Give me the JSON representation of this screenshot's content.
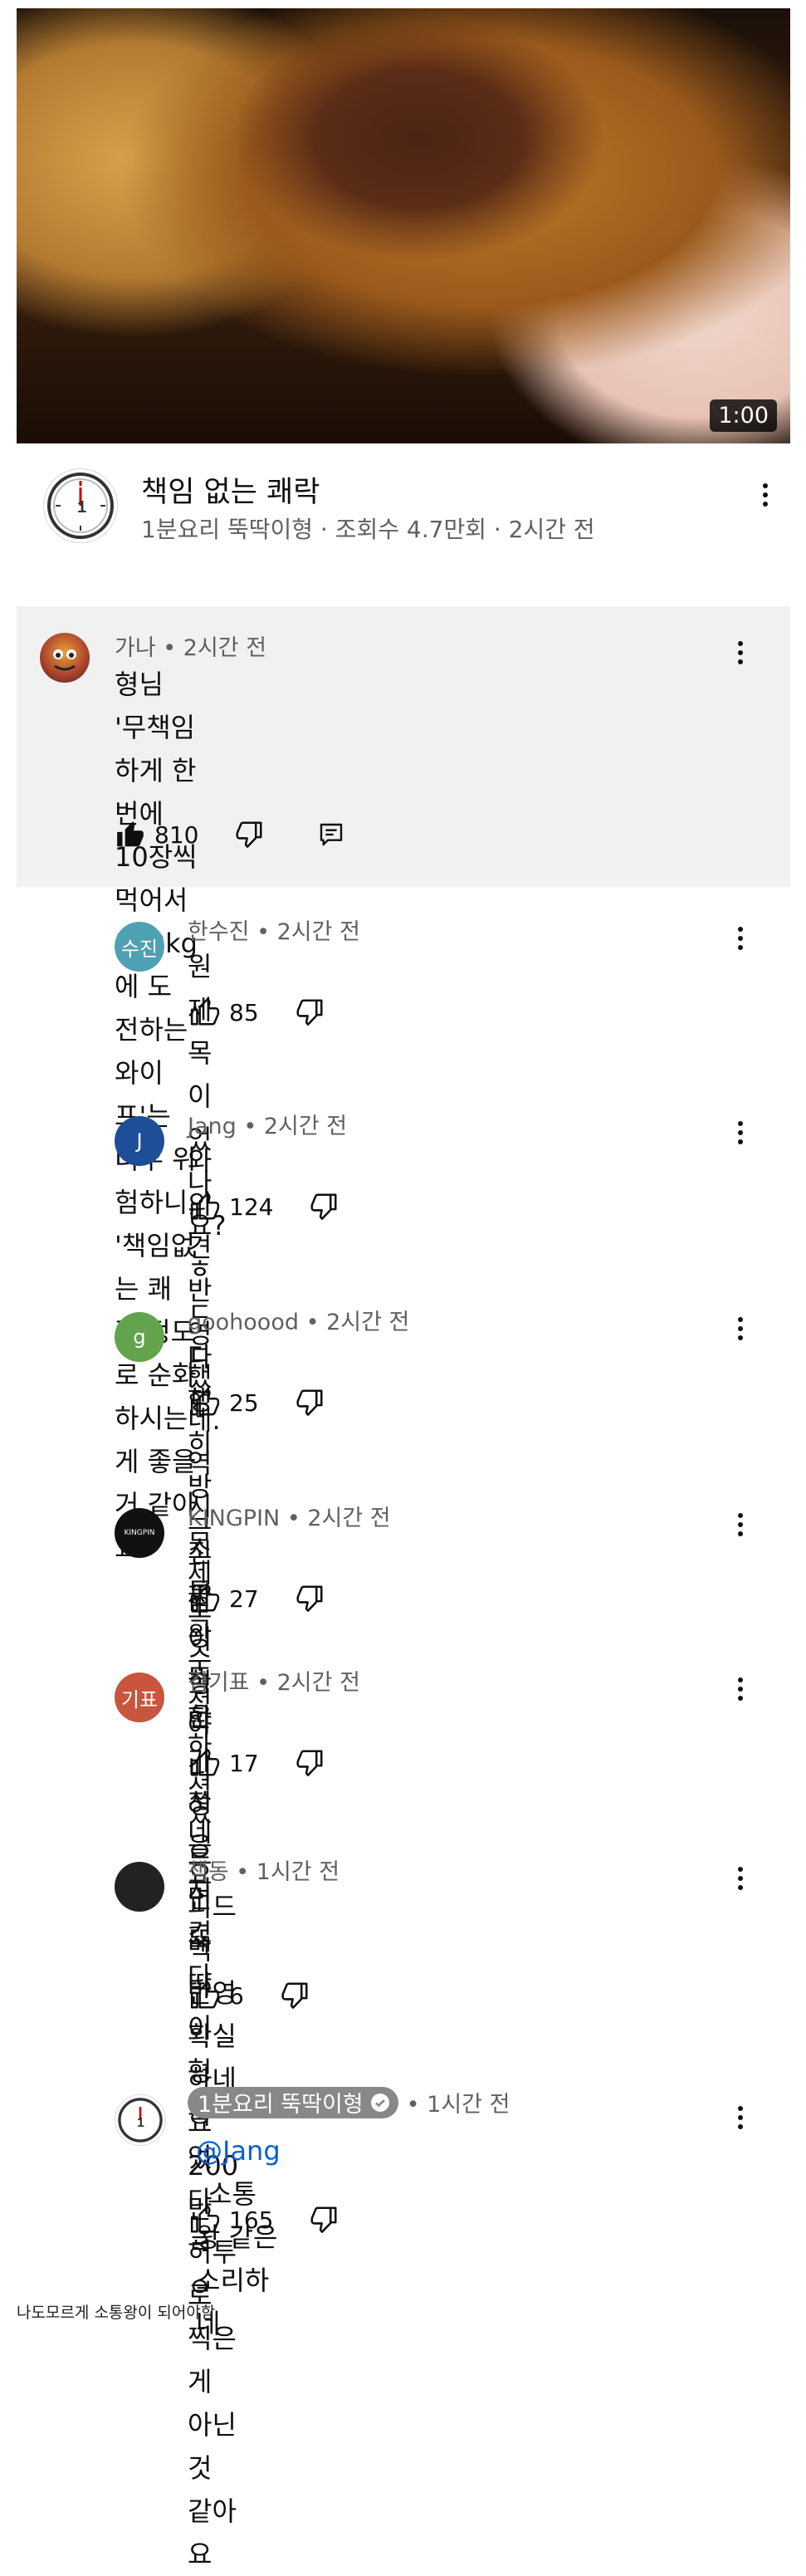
{
  "video": {
    "duration": "1:00",
    "title": "책임 없는 쾌락",
    "meta": "1분요리 뚝딱이형 · 조회수 4.7만회 · 2시간 전"
  },
  "comments": [
    {
      "author": "가나",
      "time": "• 2시간 전",
      "text_lines": [
        "형님 '무책임하게 한 번에 10장씩 먹어서 100kg에 도",
        "전하는 와이프'는 너무 위험하니, '책임없는 쾌락'정도",
        "로 순화하시는게 좋을 거 같아요"
      ],
      "likes": "810",
      "avatar": "character",
      "liked": true,
      "has_reply": true
    },
    {
      "author": "한수진",
      "time": "• 2시간 전",
      "text_lines": [
        "원제목이었나요? ㅎㄷㄷㄷ"
      ],
      "likes": "85",
      "avatar_text": "수진",
      "avatar_color": "#4ea1b3"
    },
    {
      "author": "Jang",
      "time": "• 2시간 전",
      "text_lines": [
        "와 의견 반영했네. 역시 소통왕 뚝딱"
      ],
      "likes": "124",
      "avatar_text": "J",
      "avatar_color": "#1f4e99"
    },
    {
      "author": "goohoood",
      "time": "• 2시간 전",
      "text_lines": [
        "다행히 방금 제목 수정하셨네요"
      ],
      "likes": "25",
      "avatar_text": "g",
      "avatar_color": "#62a34b"
    },
    {
      "author": "KINGPIN",
      "time": "• 2시간 전",
      "text_lines": [
        "진짜 이형 아니였으면 뚝딱이형 죽었다 ㄹㅇ"
      ],
      "likes": "27",
      "avatar_text": "KINGPIN",
      "avatar_color": "#111111"
    },
    {
      "author": "김기표",
      "time": "• 2시간 전",
      "text_lines": [
        "한 가정을 지켰다"
      ],
      "likes": "17",
      "avatar_text": "기표",
      "avatar_color": "#c8553d"
    },
    {
      "author": "책동",
      "time": "• 1시간 전",
      "text_lines": [
        "피드백 반영 확실하네요 200만 허투로 찍은 게",
        "아닌 것 같아요"
      ],
      "likes": "6",
      "avatar_text": "",
      "avatar_color": "#222222"
    },
    {
      "author": "1분요리 뚝딱이형",
      "time": "• 1시간 전",
      "mention": "@Jang",
      "text_lines": [
        "소통왕 같은 소리하네"
      ],
      "likes": "165",
      "avatar": "clock",
      "owner": true
    }
  ],
  "caption": "나도모르게 소통왕이 되어야함",
  "icons": {
    "like": "thumb-up-icon",
    "dislike": "thumb-down-icon",
    "reply": "reply-icon",
    "more": "kebab-icon",
    "verified": "verified-check-icon",
    "clock": "clock-icon"
  }
}
